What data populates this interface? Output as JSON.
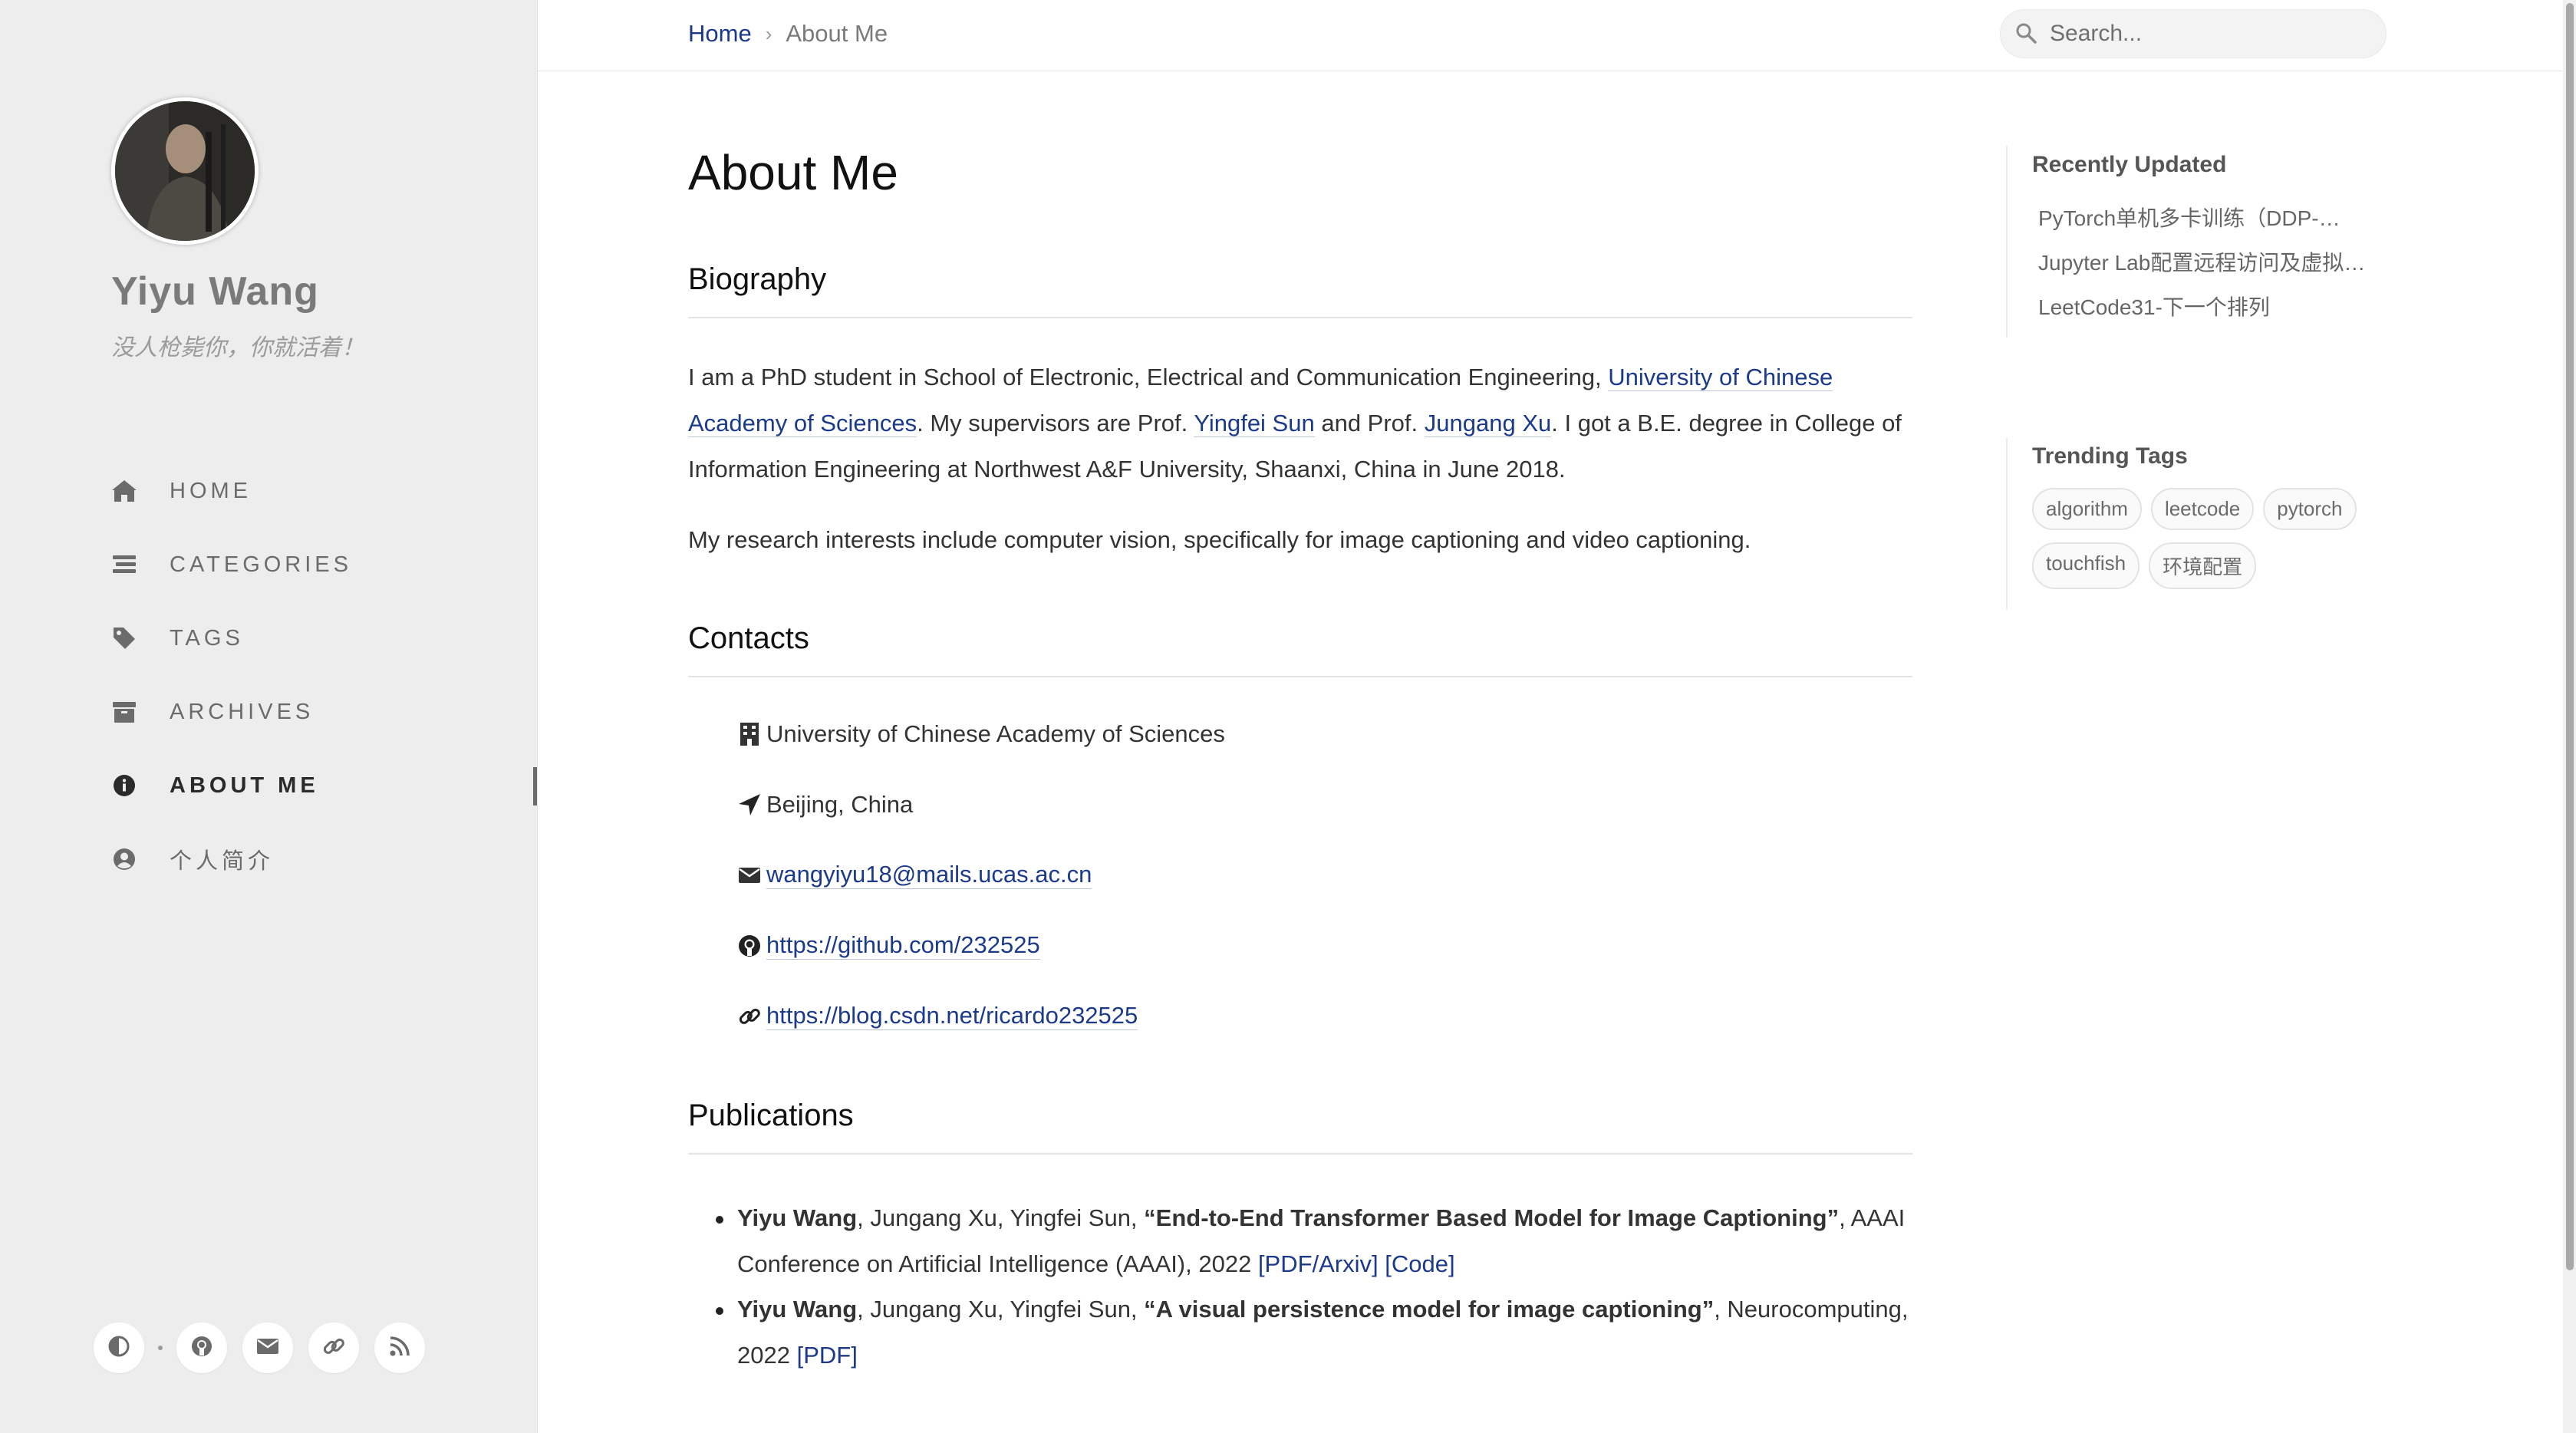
{
  "sidebar": {
    "title": "Yiyu Wang",
    "subtitle": "没人枪毙你，你就活着！",
    "nav": [
      {
        "label": "HOME",
        "icon": "home-icon"
      },
      {
        "label": "CATEGORIES",
        "icon": "stream-icon"
      },
      {
        "label": "TAGS",
        "icon": "tag-icon"
      },
      {
        "label": "ARCHIVES",
        "icon": "archive-icon"
      },
      {
        "label": "ABOUT ME",
        "icon": "info-circle-icon",
        "active": true
      },
      {
        "label": "个人简介",
        "icon": "user-circle-icon"
      }
    ],
    "footer_icons": [
      "theme-toggle-icon",
      "github-icon",
      "email-icon",
      "link-icon",
      "rss-icon"
    ]
  },
  "topbar": {
    "breadcrumb_home": "Home",
    "breadcrumb_sep": "›",
    "breadcrumb_current": "About Me",
    "search_placeholder": "Search..."
  },
  "main": {
    "title": "About Me",
    "biography": {
      "heading": "Biography",
      "p1_a": "I am a PhD student in School of Electronic, Electrical and Communication Engineering, ",
      "p1_link1": "University of Chinese",
      "p1_link1b": "Academy of Sciences",
      "p1_b": ". My supervisors are Prof. ",
      "p1_link2": "Yingfei Sun",
      "p1_c": " and Prof. ",
      "p1_link3": "Jungang Xu",
      "p1_d": ". I got a B.E. degree in College of",
      "p1_e": "Information Engineering at Northwest A&F University, Shaanxi, China in June 2018.",
      "p2": "My research interests include computer vision, specifically for image captioning and video captioning."
    },
    "contacts": {
      "heading": "Contacts",
      "items": [
        {
          "icon": "building-icon",
          "text": "University of Chinese Academy of Sciences",
          "link": false
        },
        {
          "icon": "location-arrow-icon",
          "text": "Beijing, China",
          "link": false
        },
        {
          "icon": "envelope-icon",
          "text": "wangyiyu18@mails.ucas.ac.cn",
          "link": true
        },
        {
          "icon": "github-icon",
          "text": "https://github.com/232525",
          "link": true
        },
        {
          "icon": "link-icon",
          "text": "https://blog.csdn.net/ricardo232525",
          "link": true
        }
      ]
    },
    "publications": {
      "heading": "Publications",
      "items": [
        {
          "author_bold": "Yiyu Wang",
          "authors_rest": ", Jungang Xu, Yingfei Sun, ",
          "title": "“End-to-End Transformer Based Model for Image Captioning”",
          "venue_l1": ", AAAI",
          "venue_l2": "Conference on Artificial Intelligence (AAAI), 2022 ",
          "link1": "[PDF/Arxiv]",
          "link2": "[Code]"
        },
        {
          "author_bold": "Yiyu Wang",
          "authors_rest": ", Jungang Xu, Yingfei Sun, ",
          "title": "“A visual persistence model for image captioning”",
          "venue_l1": ", Neurocomputing,",
          "venue_l2": "2022 ",
          "link1": "[PDF]"
        }
      ]
    }
  },
  "panel": {
    "recent_title": "Recently Updated",
    "recent": [
      "PyTorch单机多卡训练（DDP-…",
      "Jupyter Lab配置远程访问及虚拟环境",
      "LeetCode31-下一个排列"
    ],
    "tags_title": "Trending Tags",
    "tags": [
      "algorithm",
      "leetcode",
      "pytorch",
      "touchfish",
      "环境配置"
    ]
  }
}
